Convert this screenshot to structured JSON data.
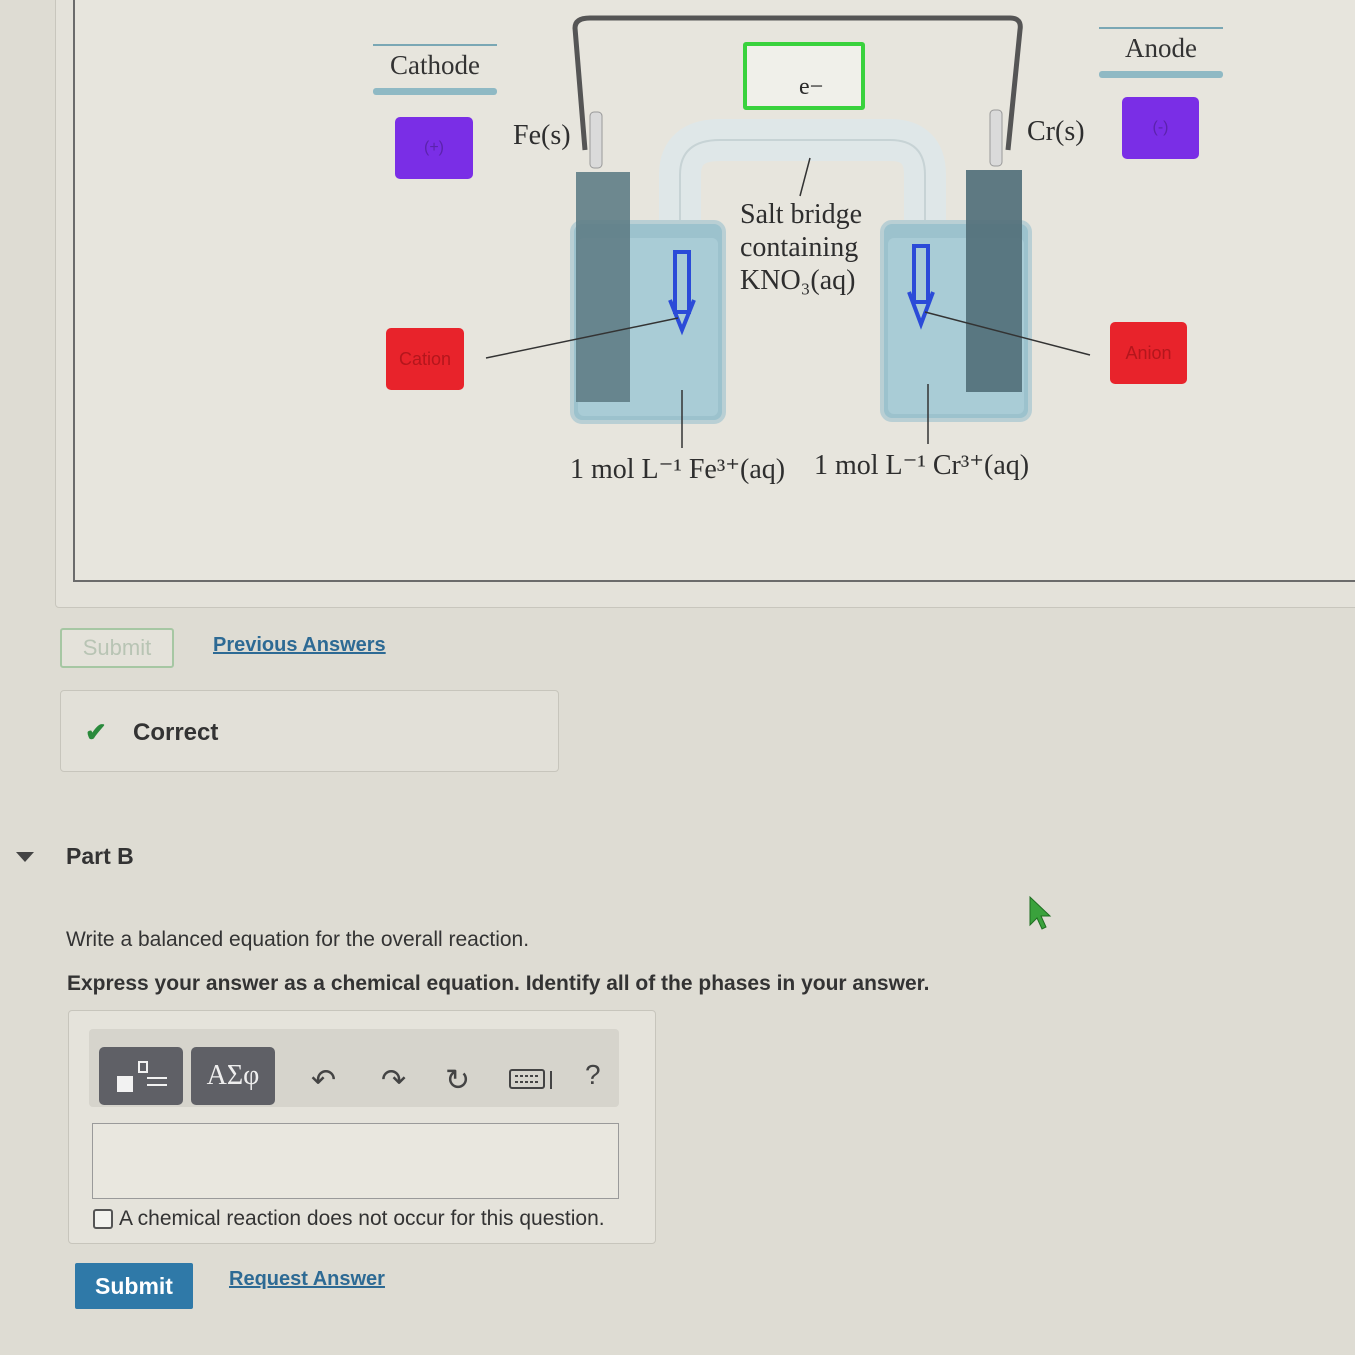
{
  "diagram": {
    "cathode_label": "Cathode",
    "anode_label": "Anode",
    "cathode_sign": "(+)",
    "anode_sign": "(-)",
    "cation_label": "Cation",
    "anion_label": "Anion",
    "electron_label": "e−",
    "left_electrode": "Fe(s)",
    "right_electrode": "Cr(s)",
    "salt_bridge_line1": "Salt bridge",
    "salt_bridge_line2": "containing",
    "salt_bridge_line3": "KNO₃(aq)",
    "left_solution": "1 mol L⁻¹ Fe³⁺(aq)",
    "right_solution": "1 mol L⁻¹ Cr³⁺(aq)"
  },
  "part_a": {
    "submit_label": "Submit",
    "previous_answers_label": "Previous Answers",
    "feedback": "Correct"
  },
  "part_b": {
    "title": "Part B",
    "question": "Write a balanced equation for the overall reaction.",
    "instruction": "Express your answer as a chemical equation. Identify all of the phases in your answer.",
    "toolbar_symbols_label": "ΑΣφ",
    "toolbar_help": "?",
    "no_reaction_label": "A chemical reaction does not occur for this question.",
    "submit_label": "Submit",
    "request_answer_label": "Request Answer"
  },
  "colors": {
    "sign_box": "#7a2ee6",
    "ion_box": "#e8232b",
    "electron_box_border": "#39d23d",
    "submit_button": "#2f79a8",
    "link": "#2d6a94",
    "check": "#2a8a3c"
  }
}
